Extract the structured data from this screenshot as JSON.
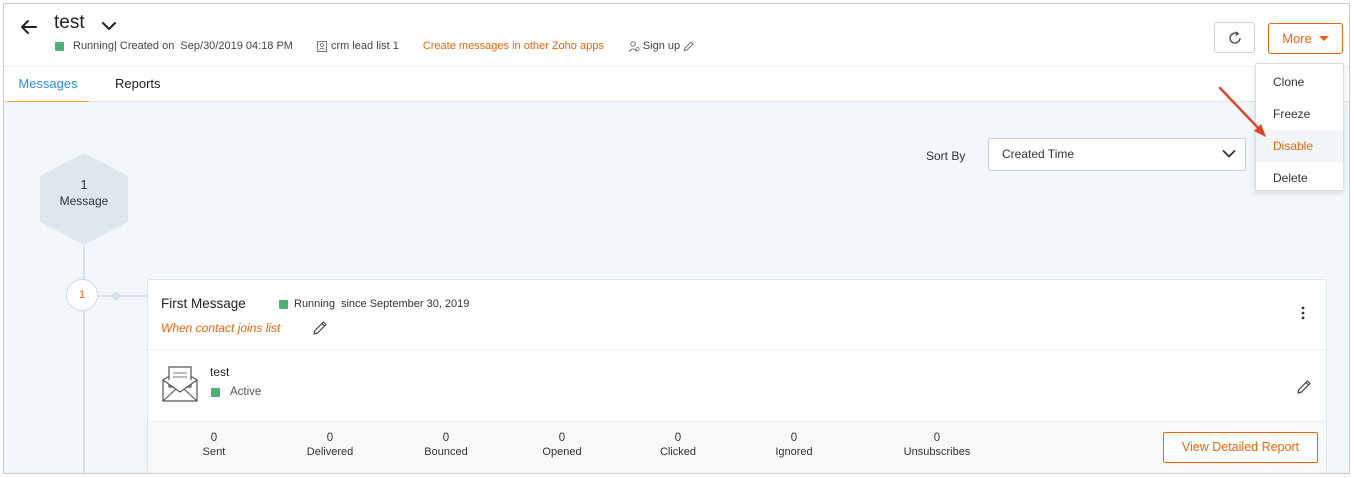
{
  "header": {
    "title": "test",
    "status": "Running",
    "created_text": "| Created on  Sep/30/2019 04:18 PM",
    "list_name": "crm lead list 1",
    "create_link": "Create messages in other Zoho apps",
    "signup": "Sign up",
    "more_label": "More"
  },
  "tabs": {
    "messages": "Messages",
    "reports": "Reports"
  },
  "sort": {
    "label": "Sort By",
    "value": "Created Time"
  },
  "summary": {
    "count": "1",
    "label": "Message"
  },
  "dropdown": {
    "items": [
      "Clone",
      "Freeze",
      "Disable",
      "Delete"
    ],
    "highlighted": "Disable"
  },
  "card": {
    "step": "1",
    "title": "First Message",
    "status": "Running",
    "since": "since September 30, 2019",
    "trigger": "When contact joins list",
    "message_name": "test",
    "message_status": "Active",
    "stats": [
      {
        "value": "0",
        "label": "Sent"
      },
      {
        "value": "0",
        "label": "Delivered"
      },
      {
        "value": "0",
        "label": "Bounced"
      },
      {
        "value": "0",
        "label": "Opened"
      },
      {
        "value": "0",
        "label": "Clicked"
      },
      {
        "value": "0",
        "label": "Ignored"
      },
      {
        "value": "0",
        "label": "Unsubscribes"
      }
    ],
    "report_button": "View Detailed Report"
  },
  "colors": {
    "accent": "#e8650c",
    "status_green": "#4caf78",
    "tab_blue": "#2a8fd8",
    "tab_underline": "#f0a030",
    "background": "#f2f7fb"
  },
  "icons": [
    "back-arrow-icon",
    "chevron-down-icon",
    "list-icon",
    "user-icon",
    "pencil-icon",
    "refresh-icon",
    "caret-down-icon",
    "kebab-menu-icon",
    "envelope-icon",
    "red-arrow-annotation"
  ]
}
